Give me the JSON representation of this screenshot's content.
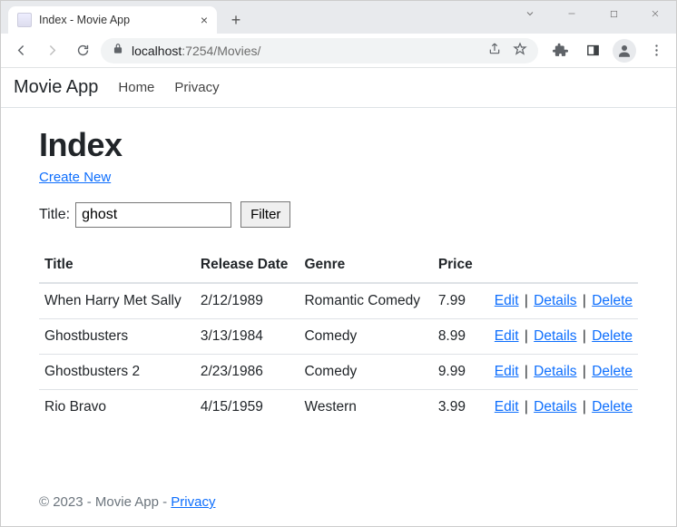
{
  "browser": {
    "tab_title": "Index - Movie App",
    "url_host": "localhost",
    "url_port": ":7254",
    "url_path": "/Movies/"
  },
  "nav": {
    "brand": "Movie App",
    "links": [
      "Home",
      "Privacy"
    ]
  },
  "page": {
    "heading": "Index",
    "create_label": "Create New",
    "filter_label": "Title:",
    "filter_value": "ghost",
    "filter_button": "Filter"
  },
  "table": {
    "headers": [
      "Title",
      "Release Date",
      "Genre",
      "Price"
    ],
    "rows": [
      {
        "title": "When Harry Met Sally",
        "release": "2/12/1989",
        "genre": "Romantic Comedy",
        "price": "7.99"
      },
      {
        "title": "Ghostbusters",
        "release": "3/13/1984",
        "genre": "Comedy",
        "price": "8.99"
      },
      {
        "title": "Ghostbusters 2",
        "release": "2/23/1986",
        "genre": "Comedy",
        "price": "9.99"
      },
      {
        "title": "Rio Bravo",
        "release": "4/15/1959",
        "genre": "Western",
        "price": "3.99"
      }
    ],
    "actions": {
      "edit": "Edit",
      "details": "Details",
      "delete": "Delete"
    }
  },
  "footer": {
    "text": "© 2023 - Movie App - ",
    "privacy": "Privacy"
  }
}
